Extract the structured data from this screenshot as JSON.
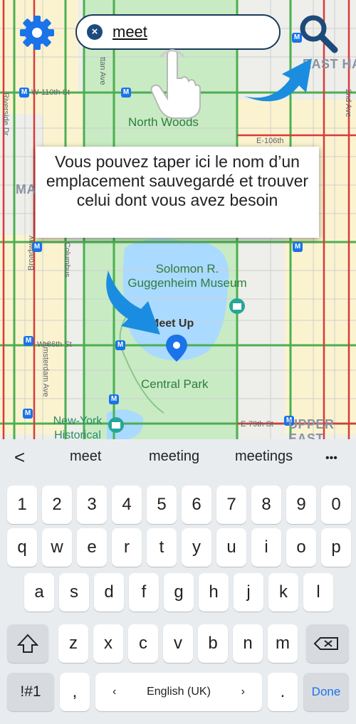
{
  "search": {
    "value": "meet"
  },
  "tooltip": {
    "text": "Vous pouvez taper ici le nom d’un emplacement sauvegardé et trouver celui dont vous avez besoin"
  },
  "map": {
    "labels": {
      "north_woods": "North Woods",
      "solomon": "Solomon R. Guggenheim Museum",
      "central_park": "Central Park",
      "meet_up": "Meet Up",
      "new_york": "New-York Historical Society",
      "east_harlem": "EAST HA",
      "upper_east": "UPPER EAST SIDE",
      "ma": "MA",
      "w110": "W-110th St",
      "w86": "W-86th St",
      "e79": "E-79th St",
      "e106": "E-106th",
      "columbus": "Columbus",
      "amsterdam": "Amsterdam Ave",
      "broadway": "Broadway",
      "ttan": "ttan Ave",
      "second_ave": "2nd Ave",
      "riverside": "Riverside Dr"
    }
  },
  "keyboard": {
    "back": "<",
    "suggestions": [
      "meet",
      "meeting",
      "meetings"
    ],
    "more": "•••",
    "numbers": [
      "1",
      "2",
      "3",
      "4",
      "5",
      "6",
      "7",
      "8",
      "9",
      "0"
    ],
    "row1": [
      "q",
      "w",
      "e",
      "r",
      "t",
      "y",
      "u",
      "i",
      "o",
      "p"
    ],
    "row2": [
      "a",
      "s",
      "d",
      "f",
      "g",
      "h",
      "j",
      "k",
      "l"
    ],
    "row3": [
      "z",
      "x",
      "c",
      "v",
      "b",
      "n",
      "m"
    ],
    "symbols": "!#1",
    "comma": ",",
    "language": "English (UK)",
    "lang_left": "‹",
    "lang_right": "›",
    "period": ".",
    "done": "Done"
  },
  "colors": {
    "accent": "#1a73e8",
    "search_border": "#1a3a5a",
    "park": "#c8ebc4",
    "water": "#aadaff"
  }
}
